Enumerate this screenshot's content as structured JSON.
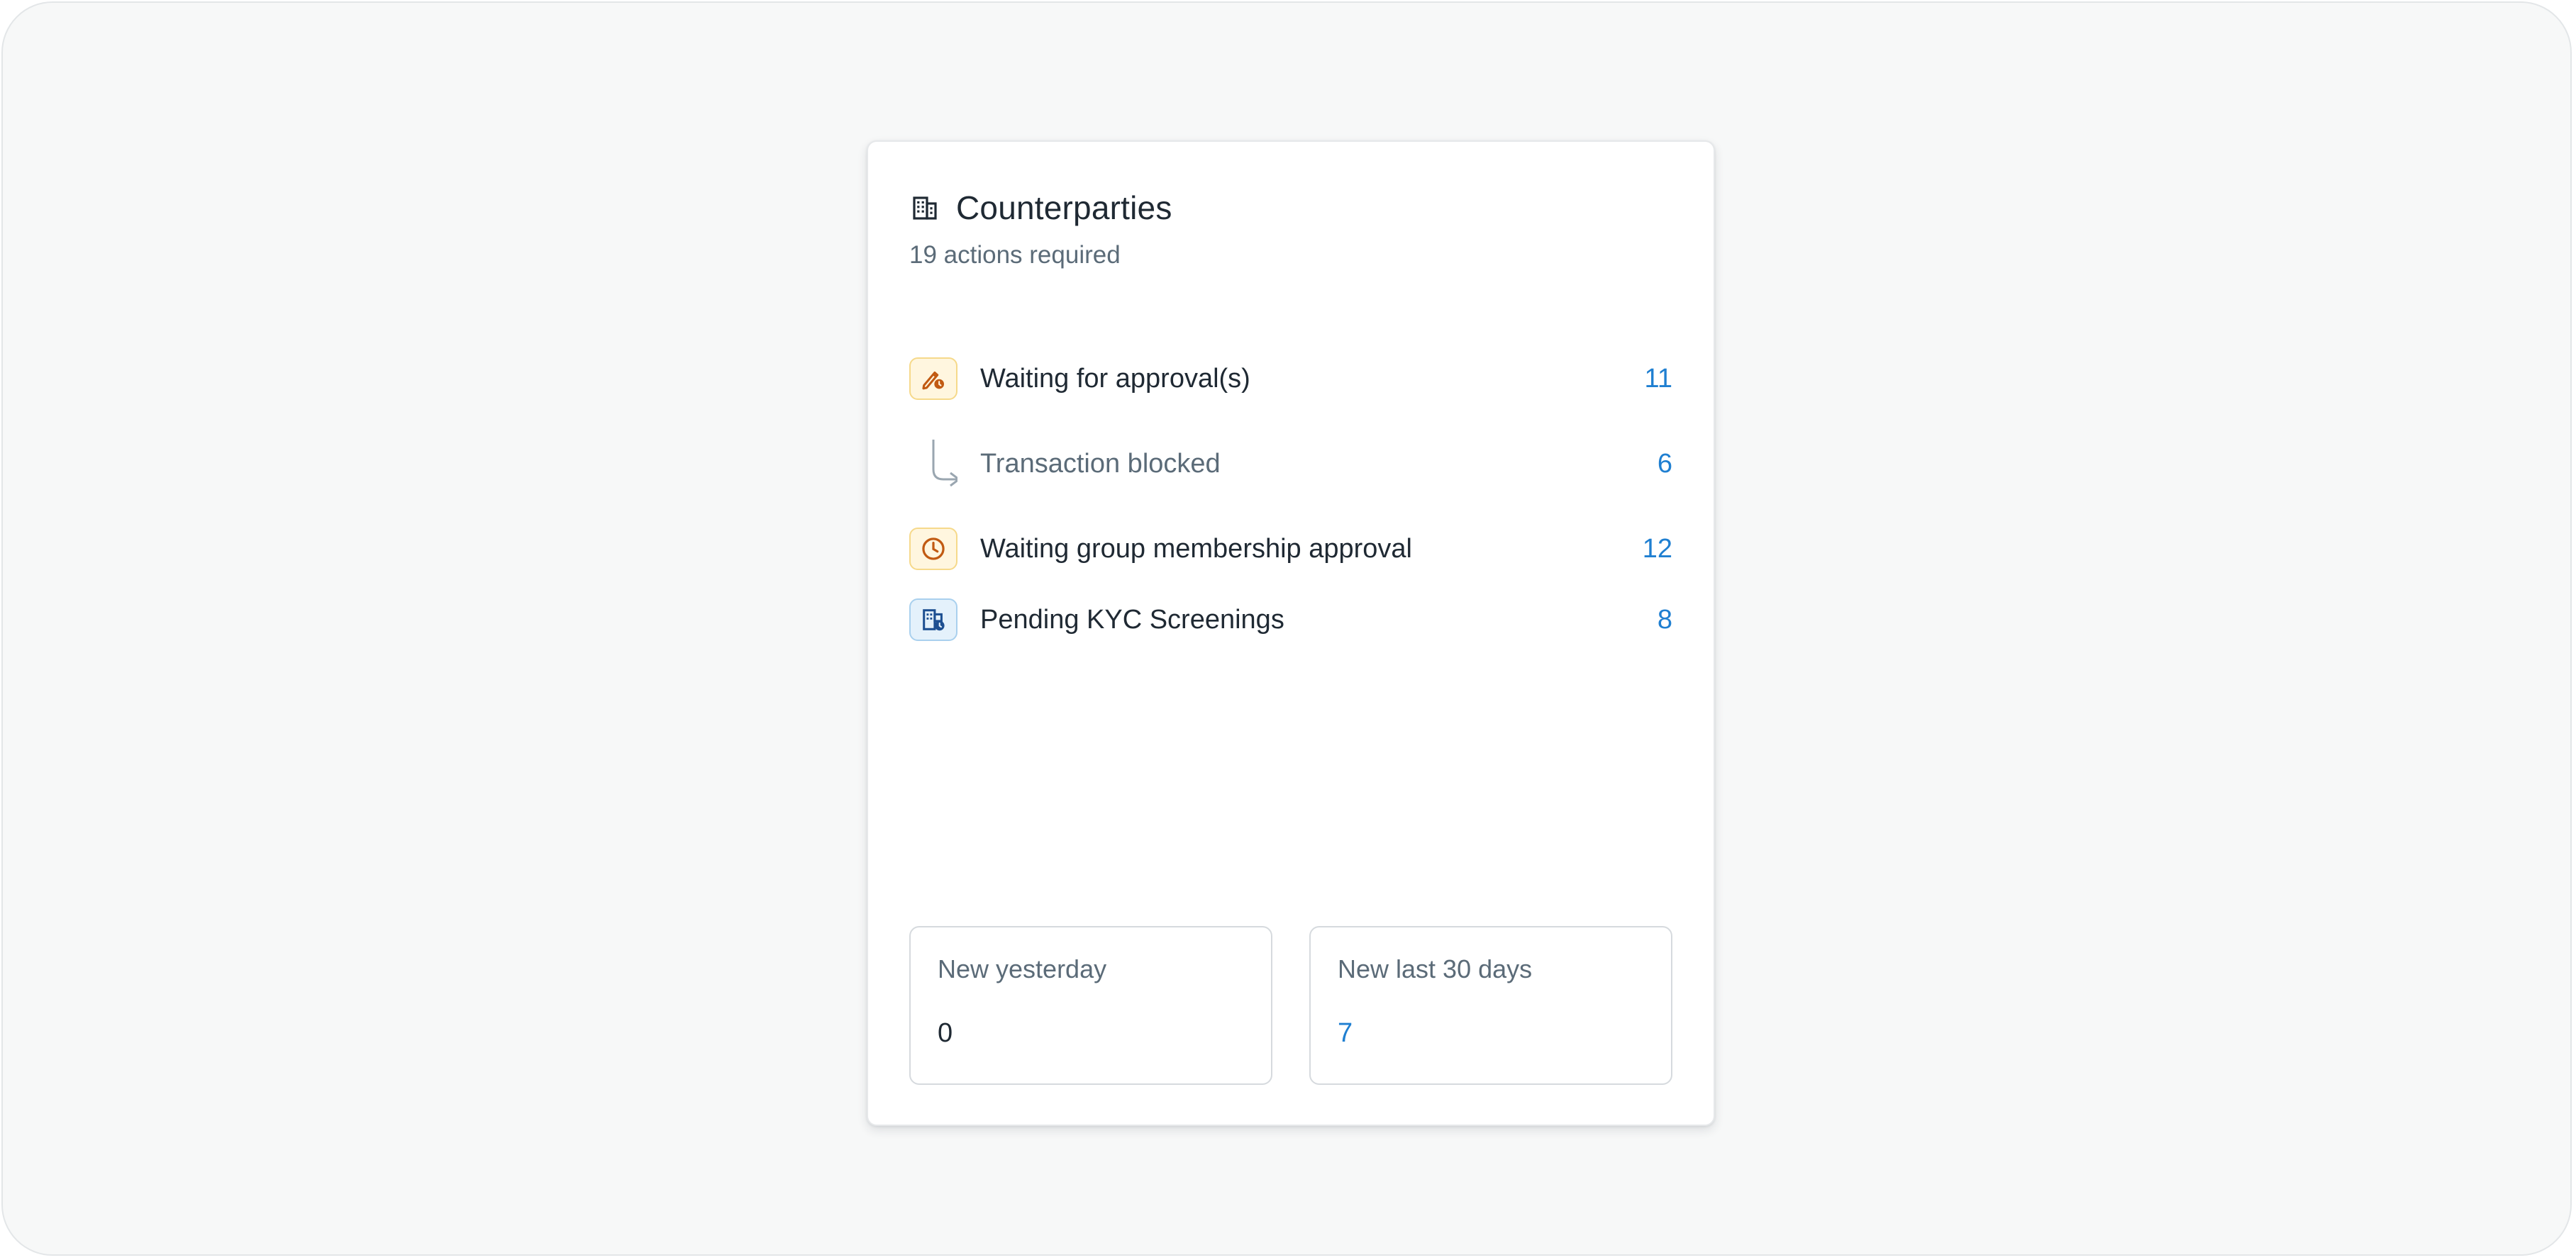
{
  "card": {
    "title": "Counterparties",
    "subtitle": "19 actions required",
    "title_icon": "building-icon"
  },
  "actions": [
    {
      "label": "Waiting for approval(s)",
      "count": "11",
      "icon": "pen-clock-icon",
      "variant": "warning"
    },
    {
      "label": "Transaction blocked",
      "count": "6",
      "icon": "sub-arrow-icon",
      "variant": "child"
    },
    {
      "label": "Waiting group membership approval",
      "count": "12",
      "icon": "clock-icon",
      "variant": "warning"
    },
    {
      "label": "Pending KYC Screenings",
      "count": "8",
      "icon": "building-clock-icon",
      "variant": "info"
    }
  ],
  "stats": {
    "yesterday": {
      "label": "New yesterday",
      "value": "0"
    },
    "last30": {
      "label": "New last 30 days",
      "value": "7"
    }
  },
  "colors": {
    "accent": "#1f7fd1",
    "warning_bg": "#fff6df",
    "warning_border": "#f6d98a",
    "warning_icon": "#c15a12",
    "info_bg": "#e4f1fb",
    "info_border": "#a9d0ee",
    "info_icon": "#1d4f91",
    "text_primary": "#1f2933",
    "text_secondary": "#5b6b78"
  }
}
